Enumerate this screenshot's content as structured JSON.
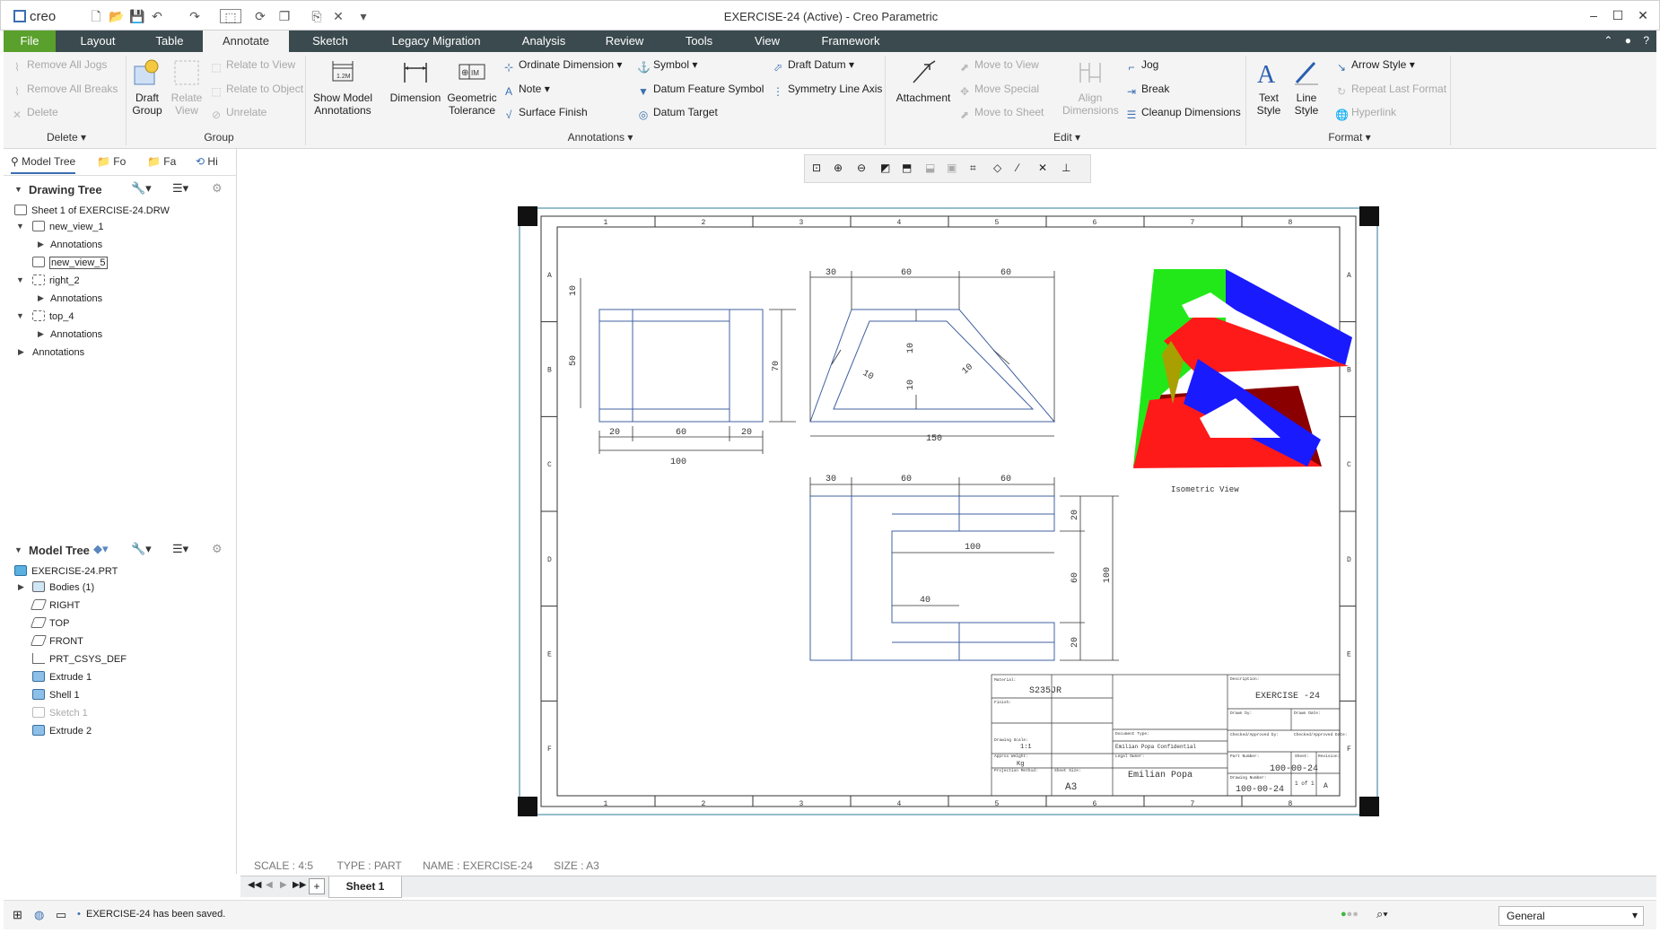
{
  "titlebar": {
    "logo": "creo",
    "title": "EXERCISE-24 (Active) - Creo Parametric"
  },
  "tabs": [
    {
      "label": "File"
    },
    {
      "label": "Layout"
    },
    {
      "label": "Table"
    },
    {
      "label": "Annotate"
    },
    {
      "label": "Sketch"
    },
    {
      "label": "Legacy Migration"
    },
    {
      "label": "Analysis"
    },
    {
      "label": "Review"
    },
    {
      "label": "Tools"
    },
    {
      "label": "View"
    },
    {
      "label": "Framework"
    }
  ],
  "ribbon": {
    "delete_group": {
      "remove_all_jogs": "Remove All Jogs",
      "remove_all_breaks": "Remove All Breaks",
      "delete": "Delete",
      "label": "Delete"
    },
    "group_group": {
      "draft_group": "Draft\nGroup",
      "relate_view": "Relate\nView",
      "relate_to_view": "Relate to View",
      "relate_to_object": "Relate to Object",
      "unrelate": "Unrelate",
      "label": "Group"
    },
    "annotations_group": {
      "show_model_annotations": "Show Model\nAnnotations",
      "dimension": "Dimension",
      "geometric_tolerance": "Geometric\nTolerance",
      "ordinate_dimension": "Ordinate Dimension",
      "note": "Note",
      "surface_finish": "Surface Finish",
      "symbol": "Symbol",
      "datum_feature_symbol": "Datum Feature Symbol",
      "datum_target": "Datum Target",
      "draft_datum": "Draft Datum",
      "symmetry_line_axis": "Symmetry Line Axis",
      "label": "Annotations"
    },
    "edit_group": {
      "attachment": "Attachment",
      "move_to_view": "Move to View",
      "move_special": "Move Special",
      "move_to_sheet": "Move to Sheet",
      "align_dimensions": "Align\nDimensions",
      "jog": "Jog",
      "break": "Break",
      "cleanup_dimensions": "Cleanup Dimensions",
      "label": "Edit"
    },
    "format_group": {
      "text_style": "Text\nStyle",
      "line_style": "Line\nStyle",
      "arrow_style": "Arrow Style",
      "repeat_last_format": "Repeat Last Format",
      "hyperlink": "Hyperlink",
      "label": "Format"
    }
  },
  "panel_tabs": [
    "Model Tree",
    "Fo",
    "Fa",
    "Hi"
  ],
  "drawing_tree": {
    "title": "Drawing Tree",
    "nodes": [
      "Sheet 1 of EXERCISE-24.DRW",
      "new_view_1",
      "Annotations",
      "new_view_5",
      "right_2",
      "Annotations",
      "top_4",
      "Annotations",
      "Annotations"
    ]
  },
  "model_tree": {
    "title": "Model Tree",
    "nodes": [
      "EXERCISE-24.PRT",
      "Bodies (1)",
      "RIGHT",
      "TOP",
      "FRONT",
      "PRT_CSYS_DEF",
      "Extrude 1",
      "Shell 1",
      "Sketch 1",
      "Extrude 2"
    ]
  },
  "drawing": {
    "col_labels": [
      "1",
      "2",
      "3",
      "4",
      "5",
      "6",
      "7",
      "8"
    ],
    "row_labels": [
      "A",
      "B",
      "C",
      "D",
      "E",
      "F"
    ],
    "front_dims": [
      "10",
      "50",
      "20",
      "60",
      "20",
      "100",
      "70"
    ],
    "top_dims": [
      "30",
      "60",
      "60",
      "10",
      "10",
      "10",
      "10",
      "150"
    ],
    "bottom_dims": [
      "30",
      "60",
      "60",
      "100",
      "40",
      "20",
      "60",
      "20",
      "100"
    ],
    "iso_label": "Isometric View",
    "title_block": {
      "material_label": "Material:",
      "material": "S235JR",
      "description_label": "Description:",
      "description": "EXERCISE -24",
      "part_number_label": "Part Number:",
      "part_number": "100-00-24",
      "drawing_number_label": "Drawing Number:",
      "drawing_number": "100-00-24",
      "sheet": "1 of 1",
      "revision": "A",
      "size": "A3",
      "scale": "1:1",
      "owner": "Emilian Popa",
      "confidential": "Emilian Popa Confidential",
      "weight": "Kg",
      "drawn_by": "Drawn by:",
      "checked_by": "Checked/Approved by:",
      "approved_date": "Checked/Approved Date:",
      "drawn_date": "Drawn Date:",
      "finish": "Finish:",
      "document_type": "Document Type:",
      "legal_owner": "Legal Owner:",
      "approx_weight": "Approx Weight:",
      "projection": "Projection Method:",
      "sheet_size": "Sheet Size:",
      "sheet_no": "Sheet:",
      "rev_label": "Revision:",
      "drawing_scale": "Drawing Scale:"
    }
  },
  "info": {
    "scale": "SCALE : 4:5",
    "type": "TYPE : PART",
    "name": "NAME : EXERCISE-24",
    "size": "SIZE : A3"
  },
  "sheet_tab": "Sheet 1",
  "status": {
    "message": "EXERCISE-24 has been saved.",
    "filter": "General"
  },
  "colors": {
    "tabbar": "#3b4a4f",
    "file_tab": "#5aa02c",
    "iso_green": "#22e81a",
    "iso_blue": "#1a1aff",
    "iso_red": "#ff1a1a",
    "iso_dark_red": "#8a0000",
    "iso_olive": "#a8a000",
    "drawing_line": "#4060a0"
  }
}
